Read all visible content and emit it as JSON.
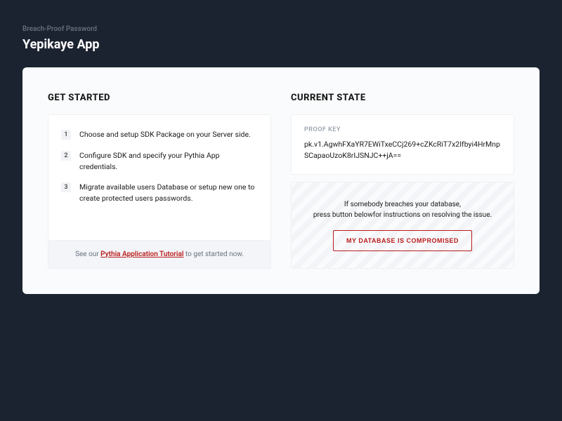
{
  "header": {
    "subtitle": "Breach-Proof Password",
    "title": "Yepikaye App"
  },
  "get_started": {
    "heading": "GET STARTED",
    "steps": [
      {
        "num": "1",
        "text": "Choose and setup SDK Package on your Server side."
      },
      {
        "num": "2",
        "text": "Configure SDK and specify your Pythia App credentials."
      },
      {
        "num": "3",
        "text": "Migrate available users Database or setup new one to create protected users passwords."
      }
    ],
    "footer_prefix": "See our ",
    "footer_link": "Pythia Application Tutorial",
    "footer_suffix": " to get started now."
  },
  "current_state": {
    "heading": "CURRENT STATE",
    "proof_label": "PROOF KEY",
    "proof_value": "pk.v1.AgwhFXaYR7EWiTxeCCj269+cZKcRiT7x2Ifbyi4HrMnpSCapaoUzoK8rIJSNJC++jA==",
    "breach_line1": "If somebody breaches your database,",
    "breach_line2": "press button belowfor instructions on resolving the issue.",
    "breach_button": "MY DATABASE IS COMPROMISED"
  }
}
